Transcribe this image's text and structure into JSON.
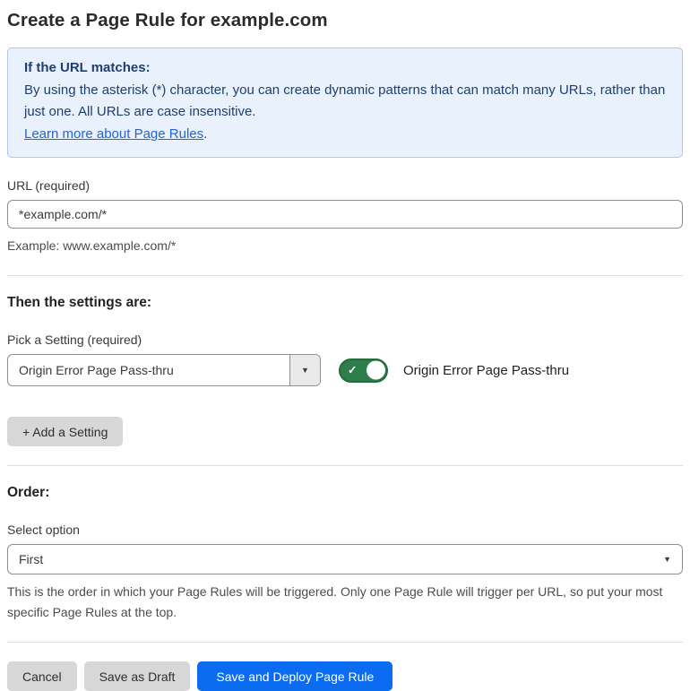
{
  "page": {
    "title": "Create a Page Rule for example.com"
  },
  "info_box": {
    "heading": "If the URL matches:",
    "body": "By using the asterisk (*) character, you can create dynamic patterns that can match many URLs, rather than just one. All URLs are case insensitive.",
    "link_label": "Learn more about Page Rules",
    "link_suffix": "."
  },
  "url_field": {
    "label": "URL (required)",
    "value": "*example.com/*",
    "helper": "Example: www.example.com/*"
  },
  "settings_section": {
    "heading": "Then the settings are:",
    "pick_label": "Pick a Setting (required)",
    "selected_setting": "Origin Error Page Pass-thru",
    "toggle_label": "Origin Error Page Pass-thru",
    "toggle_state": "on",
    "add_setting_label": "+ Add a Setting"
  },
  "order_section": {
    "heading": "Order:",
    "select_label": "Select option",
    "selected_option": "First",
    "helper": "This is the order in which your Page Rules will be triggered. Only one Page Rule will trigger per URL, so put your most specific Page Rules at the top."
  },
  "footer": {
    "cancel_label": "Cancel",
    "save_draft_label": "Save as Draft",
    "save_deploy_label": "Save and Deploy Page Rule"
  },
  "icons": {
    "dropdown_caret": "▼",
    "toggle_check": "✓"
  },
  "colors": {
    "accent_blue": "#0b6cf2",
    "info_bg": "#e9f1fc",
    "info_border": "#abc9ea",
    "info_text": "#1e3f6f",
    "link_blue": "#2365d6",
    "toggle_green": "#2f7d4a",
    "toggle_green_border": "#266b3d",
    "button_gray": "#d7d7d7"
  }
}
